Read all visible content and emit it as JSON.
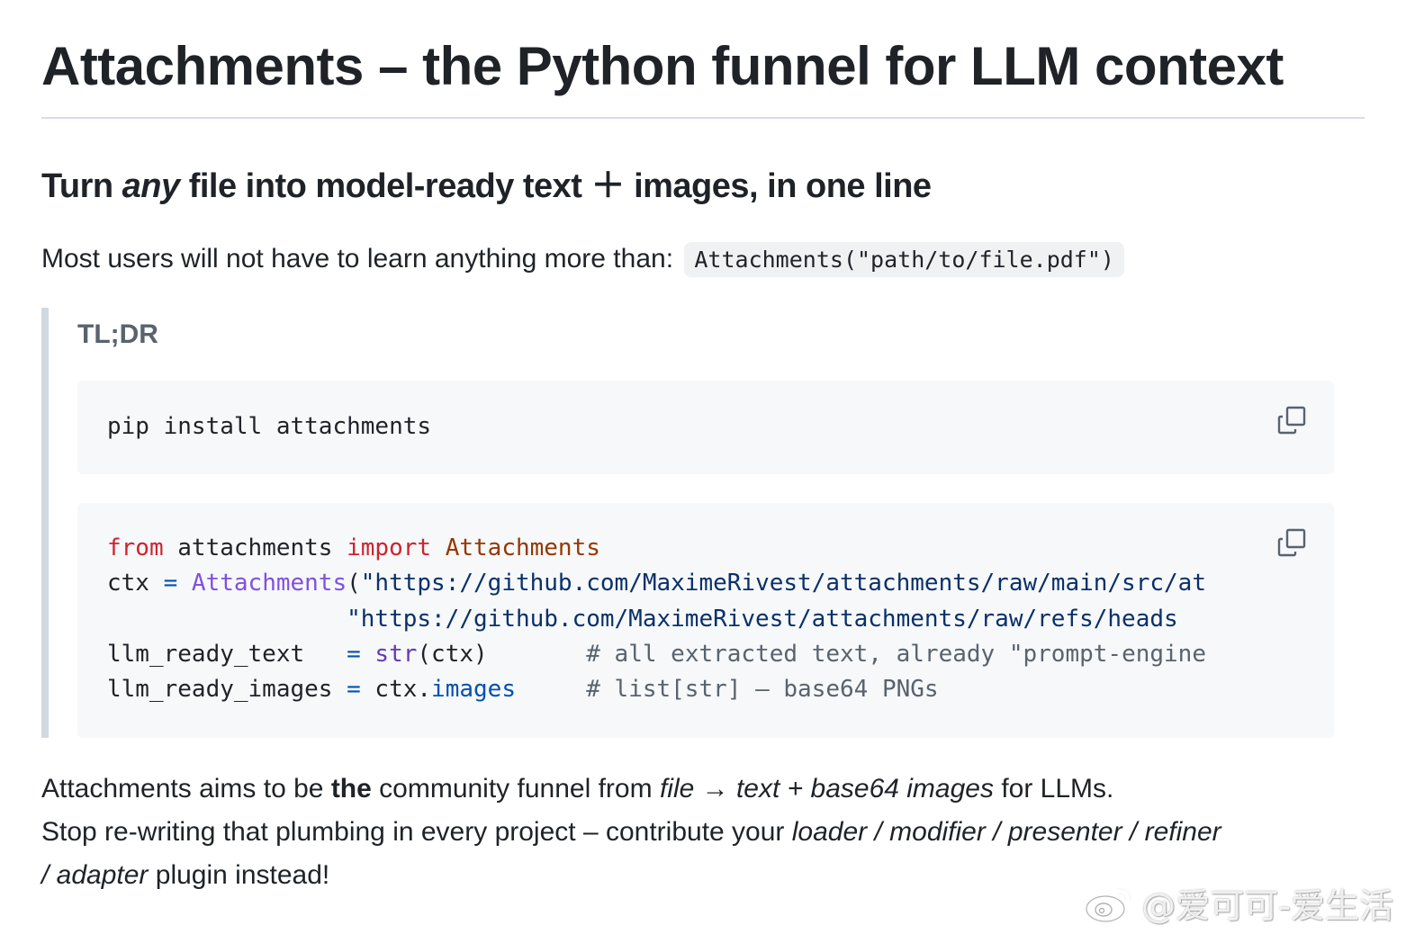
{
  "title": "Attachments – the Python funnel for LLM context",
  "subtitle": {
    "before": "Turn ",
    "emph": "any",
    "after": " file into model-ready text ＋ images, in one line"
  },
  "intro": {
    "text": "Most users will not have to learn anything more than:",
    "code": "Attachments(\"path/to/file.pdf\")"
  },
  "tldr": {
    "label": "TL;DR",
    "install_cmd": "pip install attachments",
    "code": {
      "line1": {
        "kw1": "from",
        "mod": " attachments ",
        "kw2": "import",
        "cls": " Attachments"
      },
      "line2": {
        "var": "ctx ",
        "op": "=",
        "fn": " Attachments",
        "paren": "(",
        "str": "\"https://github.com/MaximeRivest/attachments/raw/main/src/at"
      },
      "line3": {
        "indent": "                 ",
        "str": "\"https://github.com/MaximeRivest/attachments/raw/refs/heads"
      },
      "line4": {
        "var": "llm_ready_text   ",
        "op": "=",
        "bi": " str",
        "args": "(ctx)",
        "cm": "       # all extracted text, already \"prompt-engine"
      },
      "line5": {
        "var": "llm_ready_images ",
        "op": "=",
        "obj": " ctx.",
        "attr": "images",
        "cm": "     # list[str] – base64 PNGs"
      }
    },
    "copy_icon": "copy-icon"
  },
  "paragraphs": {
    "p1": {
      "t1": "Attachments aims to be ",
      "b1": "the",
      "t2": " community funnel from ",
      "i1": "file",
      "t3": " → ",
      "i2": "text + base64 images",
      "t4": " for LLMs."
    },
    "p2": {
      "t1": "Stop re-writing that plumbing in every project – contribute your ",
      "i1": "loader / modifier / presenter / refiner"
    },
    "p3": {
      "i1": "/ adapter",
      "t1": " plugin instead!"
    }
  },
  "watermark": {
    "icon": "weibo-icon",
    "text": "@爱可可-爱生活"
  }
}
